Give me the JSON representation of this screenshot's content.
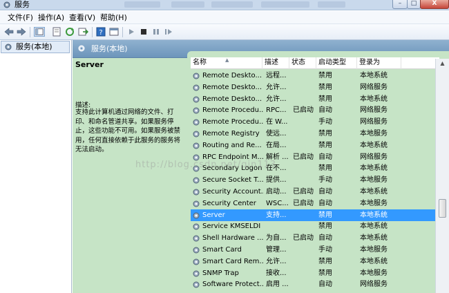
{
  "window": {
    "title": "服务",
    "min_label": "–",
    "max_label": "□",
    "close_label": "X"
  },
  "menubar": {
    "items": [
      "文件(F)",
      "操作(A)",
      "查看(V)",
      "帮助(H)"
    ]
  },
  "left_pane": {
    "node": "服务(本地)"
  },
  "right_pane": {
    "header": "服务(本地)",
    "details": {
      "service_name": "Server",
      "desc_label": "描述:",
      "desc_text": "支持此计算机通过网络的文件、打印、和命名管道共享。如果服务停止，这些功能不可用。如果服务被禁用，任何直接依赖于此服务的服务将无法启动。"
    },
    "columns": [
      "名称",
      "描述",
      "状态",
      "启动类型",
      "登录为"
    ],
    "rows": [
      {
        "name": "Remote Deskto...",
        "desc": "远程...",
        "state": "",
        "start": "禁用",
        "logon": "本地系统"
      },
      {
        "name": "Remote Deskto...",
        "desc": "允许...",
        "state": "",
        "start": "禁用",
        "logon": "网络服务"
      },
      {
        "name": "Remote Deskto...",
        "desc": "允许...",
        "state": "",
        "start": "禁用",
        "logon": "本地系统"
      },
      {
        "name": "Remote Procedu...",
        "desc": "RPC...",
        "state": "已启动",
        "start": "自动",
        "logon": "网络服务"
      },
      {
        "name": "Remote Procedu...",
        "desc": "在 W...",
        "state": "",
        "start": "手动",
        "logon": "网络服务"
      },
      {
        "name": "Remote Registry",
        "desc": "使远...",
        "state": "",
        "start": "禁用",
        "logon": "本地服务"
      },
      {
        "name": "Routing and Re...",
        "desc": "在局...",
        "state": "",
        "start": "禁用",
        "logon": "本地系统"
      },
      {
        "name": "RPC Endpoint M...",
        "desc": "解析 ...",
        "state": "已启动",
        "start": "自动",
        "logon": "网络服务"
      },
      {
        "name": "Secondary Logon",
        "desc": "在不...",
        "state": "",
        "start": "禁用",
        "logon": "本地系统"
      },
      {
        "name": "Secure Socket T...",
        "desc": "提供...",
        "state": "",
        "start": "手动",
        "logon": "本地服务"
      },
      {
        "name": "Security Account...",
        "desc": "启动...",
        "state": "已启动",
        "start": "自动",
        "logon": "本地系统"
      },
      {
        "name": "Security Center",
        "desc": "WSC...",
        "state": "已启动",
        "start": "自动",
        "logon": "本地服务"
      },
      {
        "name": "Server",
        "desc": "支持...",
        "state": "",
        "start": "禁用",
        "logon": "本地系统",
        "selected": true
      },
      {
        "name": "Service KMSELDI",
        "desc": "",
        "state": "",
        "start": "禁用",
        "logon": "本地系统"
      },
      {
        "name": "Shell Hardware ...",
        "desc": "为自...",
        "state": "已启动",
        "start": "自动",
        "logon": "本地系统"
      },
      {
        "name": "Smart Card",
        "desc": "管理...",
        "state": "",
        "start": "手动",
        "logon": "本地服务"
      },
      {
        "name": "Smart Card Rem...",
        "desc": "允许...",
        "state": "",
        "start": "禁用",
        "logon": "本地系统"
      },
      {
        "name": "SNMP Trap",
        "desc": "接收...",
        "state": "",
        "start": "禁用",
        "logon": "本地服务"
      },
      {
        "name": "Software Protect...",
        "desc": "启用 ...",
        "state": "",
        "start": "自动",
        "logon": "网络服务"
      }
    ]
  },
  "watermark": "http://blog.csdn.net/qin113",
  "colors": {
    "pane_green": "#c6e4c6",
    "selection": "#3399ff",
    "header_blue": "#7a9fc4"
  },
  "toolbar_icons": [
    "back-icon",
    "forward-icon",
    "console-tree-icon",
    "properties-icon",
    "refresh-icon",
    "export-icon",
    "help-icon",
    "view-icon",
    "play-icon",
    "stop-icon",
    "pause-icon",
    "restart-icon"
  ]
}
